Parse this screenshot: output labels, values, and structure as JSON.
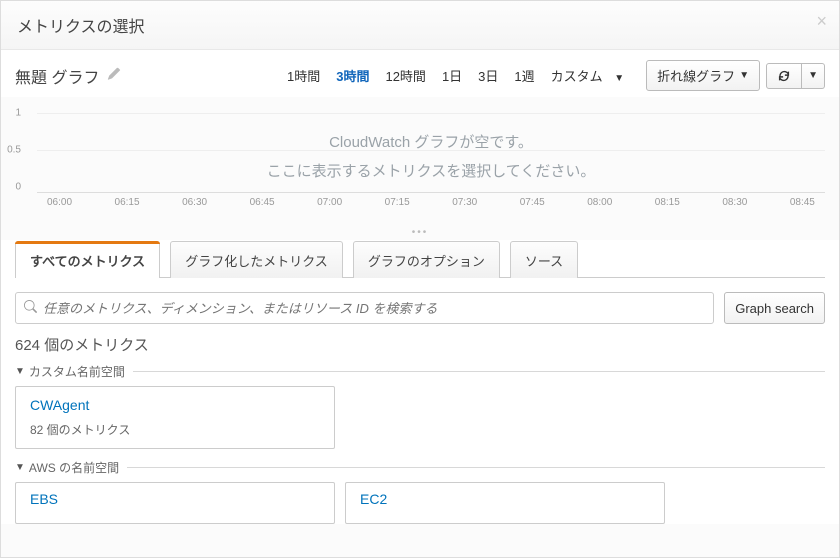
{
  "header": {
    "title": "メトリクスの選択"
  },
  "graph": {
    "title": "無題 グラフ",
    "empty_line1": "CloudWatch グラフが空です。",
    "empty_line2": "ここに表示するメトリクスを選択してください。",
    "y_ticks": [
      "1",
      "0.5",
      "0"
    ],
    "x_ticks": [
      "06:00",
      "06:15",
      "06:30",
      "06:45",
      "07:00",
      "07:15",
      "07:30",
      "07:45",
      "08:00",
      "08:15",
      "08:30",
      "08:45"
    ]
  },
  "time_range": {
    "options": [
      "1時間",
      "3時間",
      "12時間",
      "1日",
      "3日",
      "1週"
    ],
    "custom": "カスタム",
    "active_index": 1
  },
  "controls": {
    "chart_type": "折れ線グラフ"
  },
  "tabs": {
    "items": [
      "すべてのメトリクス",
      "グラフ化したメトリクス",
      "グラフのオプション",
      "ソース"
    ],
    "active_index": 0
  },
  "search": {
    "placeholder": "任意のメトリクス、ディメンション、またはリソース ID を検索する",
    "graph_search_label": "Graph search"
  },
  "metrics": {
    "count_label": "624 個のメトリクス",
    "groups": [
      {
        "title": "カスタム名前空間",
        "items": [
          {
            "name": "CWAgent",
            "sub": "82 個のメトリクス"
          }
        ]
      },
      {
        "title": "AWS の名前空間",
        "items": [
          {
            "name": "EBS",
            "sub": ""
          },
          {
            "name": "EC2",
            "sub": ""
          }
        ]
      }
    ]
  },
  "chart_data": {
    "type": "line",
    "series": [],
    "xlabel": "",
    "ylabel": "",
    "ylim": [
      0,
      1
    ],
    "x_categories": [
      "06:00",
      "06:15",
      "06:30",
      "06:45",
      "07:00",
      "07:15",
      "07:30",
      "07:45",
      "08:00",
      "08:15",
      "08:30",
      "08:45"
    ],
    "title": "無題 グラフ",
    "note": "empty chart"
  }
}
